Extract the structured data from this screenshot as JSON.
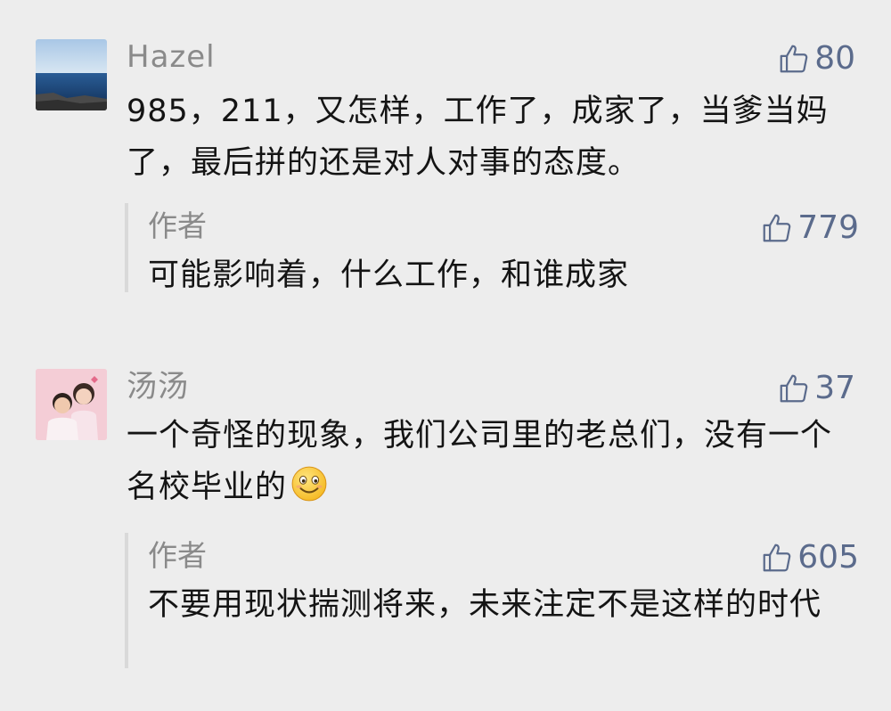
{
  "comments": [
    {
      "username": "Hazel",
      "likes": "80",
      "text": "985，211，又怎样，工作了，成家了，当爹当妈了，最后拼的还是对人对事的态度。",
      "avatar": "ocean-photo-avatar",
      "reply": {
        "author": "作者",
        "likes": "779",
        "text": "可能影响着，什么工作，和谁成家"
      }
    },
    {
      "username": "汤汤",
      "likes": "37",
      "text": "一个奇怪的现象，我们公司里的老总们，没有一个名校毕业的",
      "emoji": "smiling-face-emoji",
      "avatar": "family-photo-avatar",
      "reply": {
        "author": "作者",
        "likes": "605",
        "text": "不要用现状揣测将来，未来注定不是这样的时代"
      }
    }
  ],
  "colors": {
    "background": "#ededed",
    "username": "#8a8a8a",
    "like": "#5b6b8c",
    "text": "#141414",
    "reply_bar": "#d9d9d9"
  }
}
